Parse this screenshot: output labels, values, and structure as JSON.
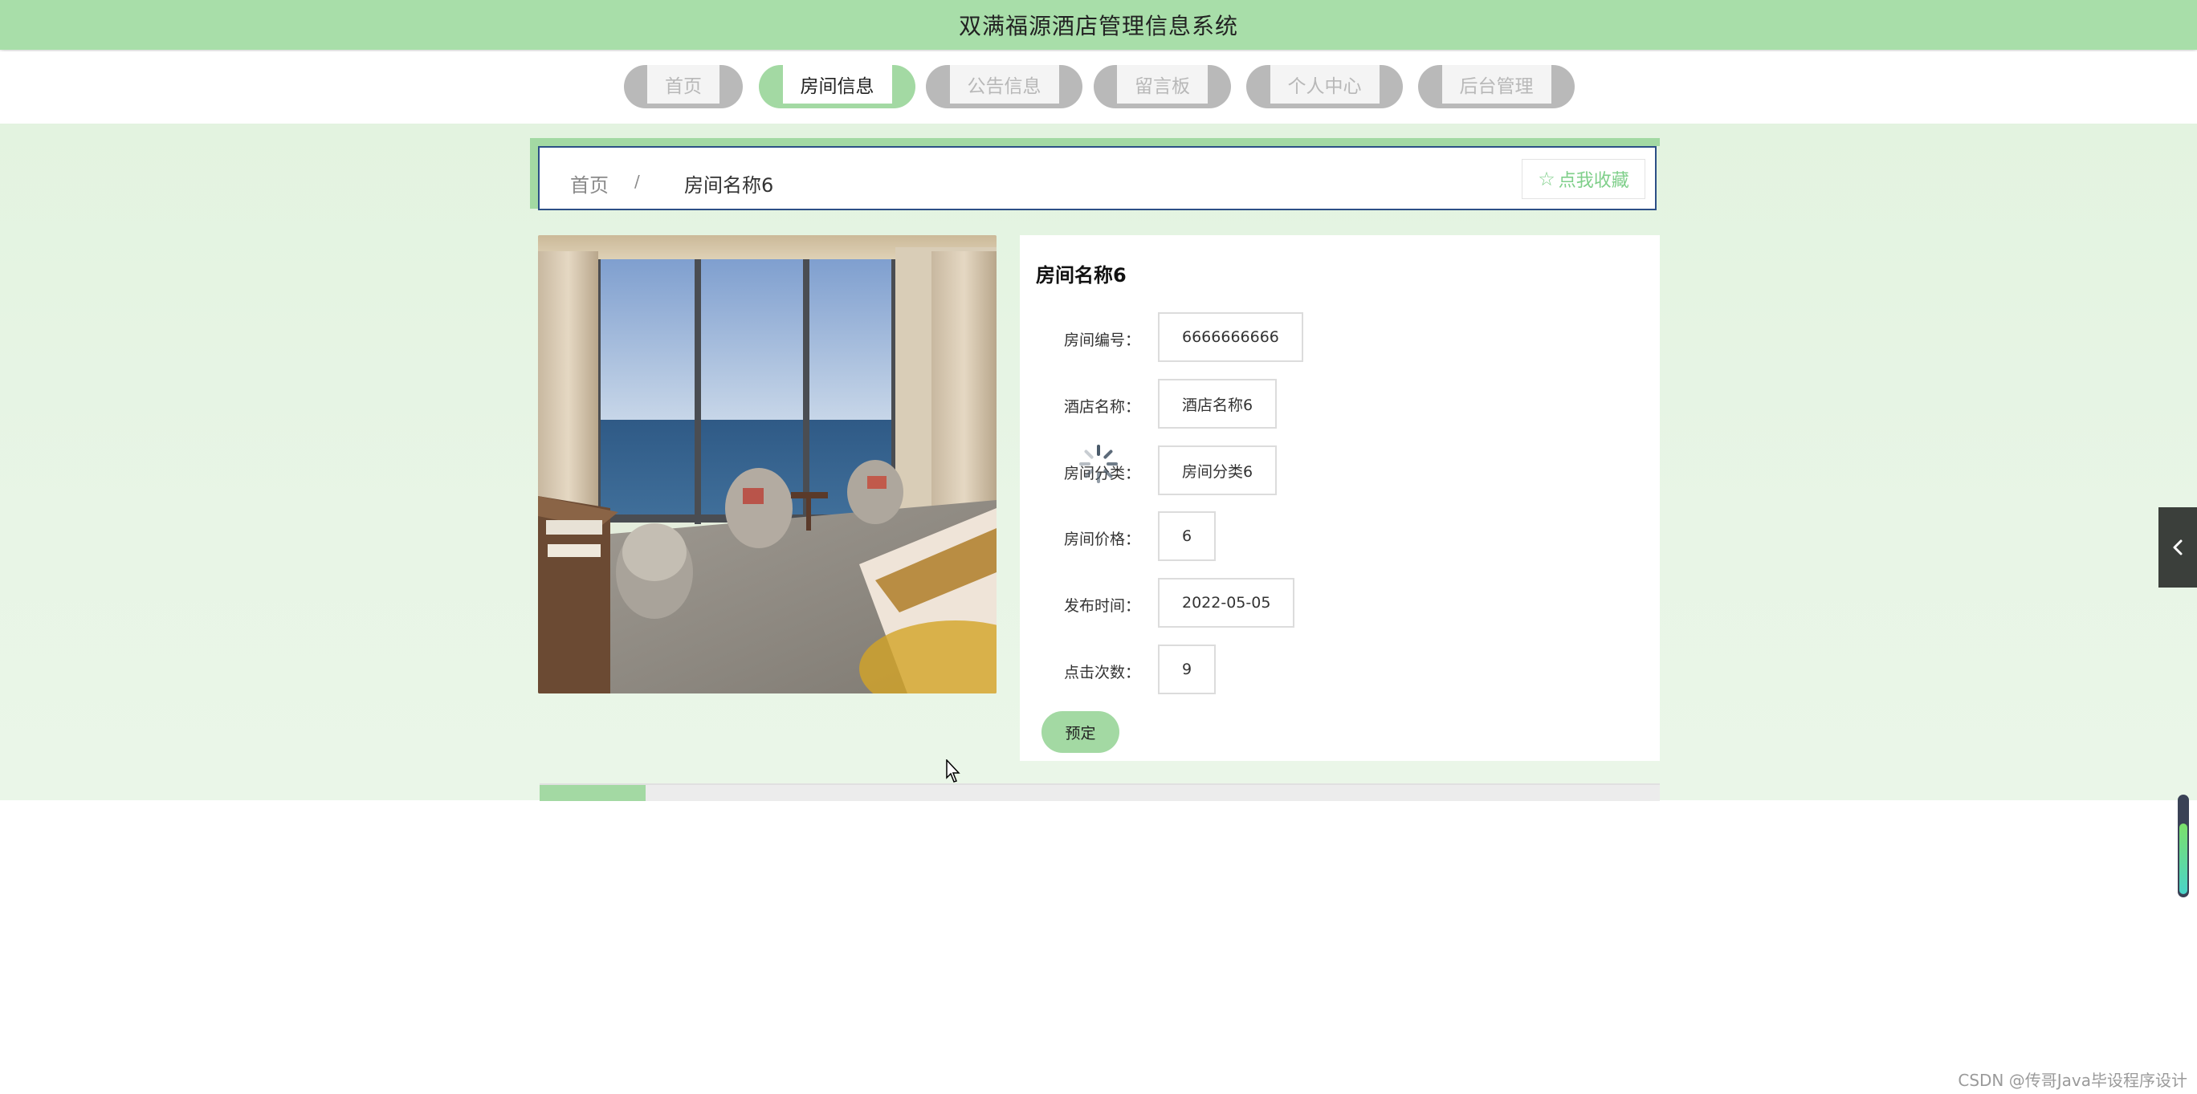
{
  "app": {
    "title": "双满福源酒店管理信息系统"
  },
  "nav": {
    "items": [
      {
        "label": "首页",
        "active": false
      },
      {
        "label": "房间信息",
        "active": true
      },
      {
        "label": "公告信息",
        "active": false
      },
      {
        "label": "留言板",
        "active": false
      },
      {
        "label": "个人中心",
        "active": false
      },
      {
        "label": "后台管理",
        "active": false
      }
    ]
  },
  "breadcrumb": {
    "home": "首页",
    "separator": "/",
    "current": "房间名称6",
    "favorite_label": "点我收藏"
  },
  "room": {
    "title": "房间名称6",
    "fields": [
      {
        "label": "房间编号：",
        "value": "6666666666"
      },
      {
        "label": "酒店名称：",
        "value": "酒店名称6"
      },
      {
        "label": "房间分类：",
        "value": "房间分类6"
      },
      {
        "label": "房间价格：",
        "value": "6"
      },
      {
        "label": "发布时间：",
        "value": "2022-05-05"
      },
      {
        "label": "点击次数：",
        "value": "9"
      }
    ],
    "book_label": "预定"
  },
  "colors": {
    "accent": "#a3d9a3",
    "titlebar": "#a8dea9",
    "breadcrumb_border": "#2c4f86"
  },
  "icons": {
    "favorite": "star-outline-icon",
    "side_toggle": "chevron-left-icon",
    "loading": "spinner-icon"
  },
  "watermark": "CSDN @传哥Java毕设程序设计"
}
